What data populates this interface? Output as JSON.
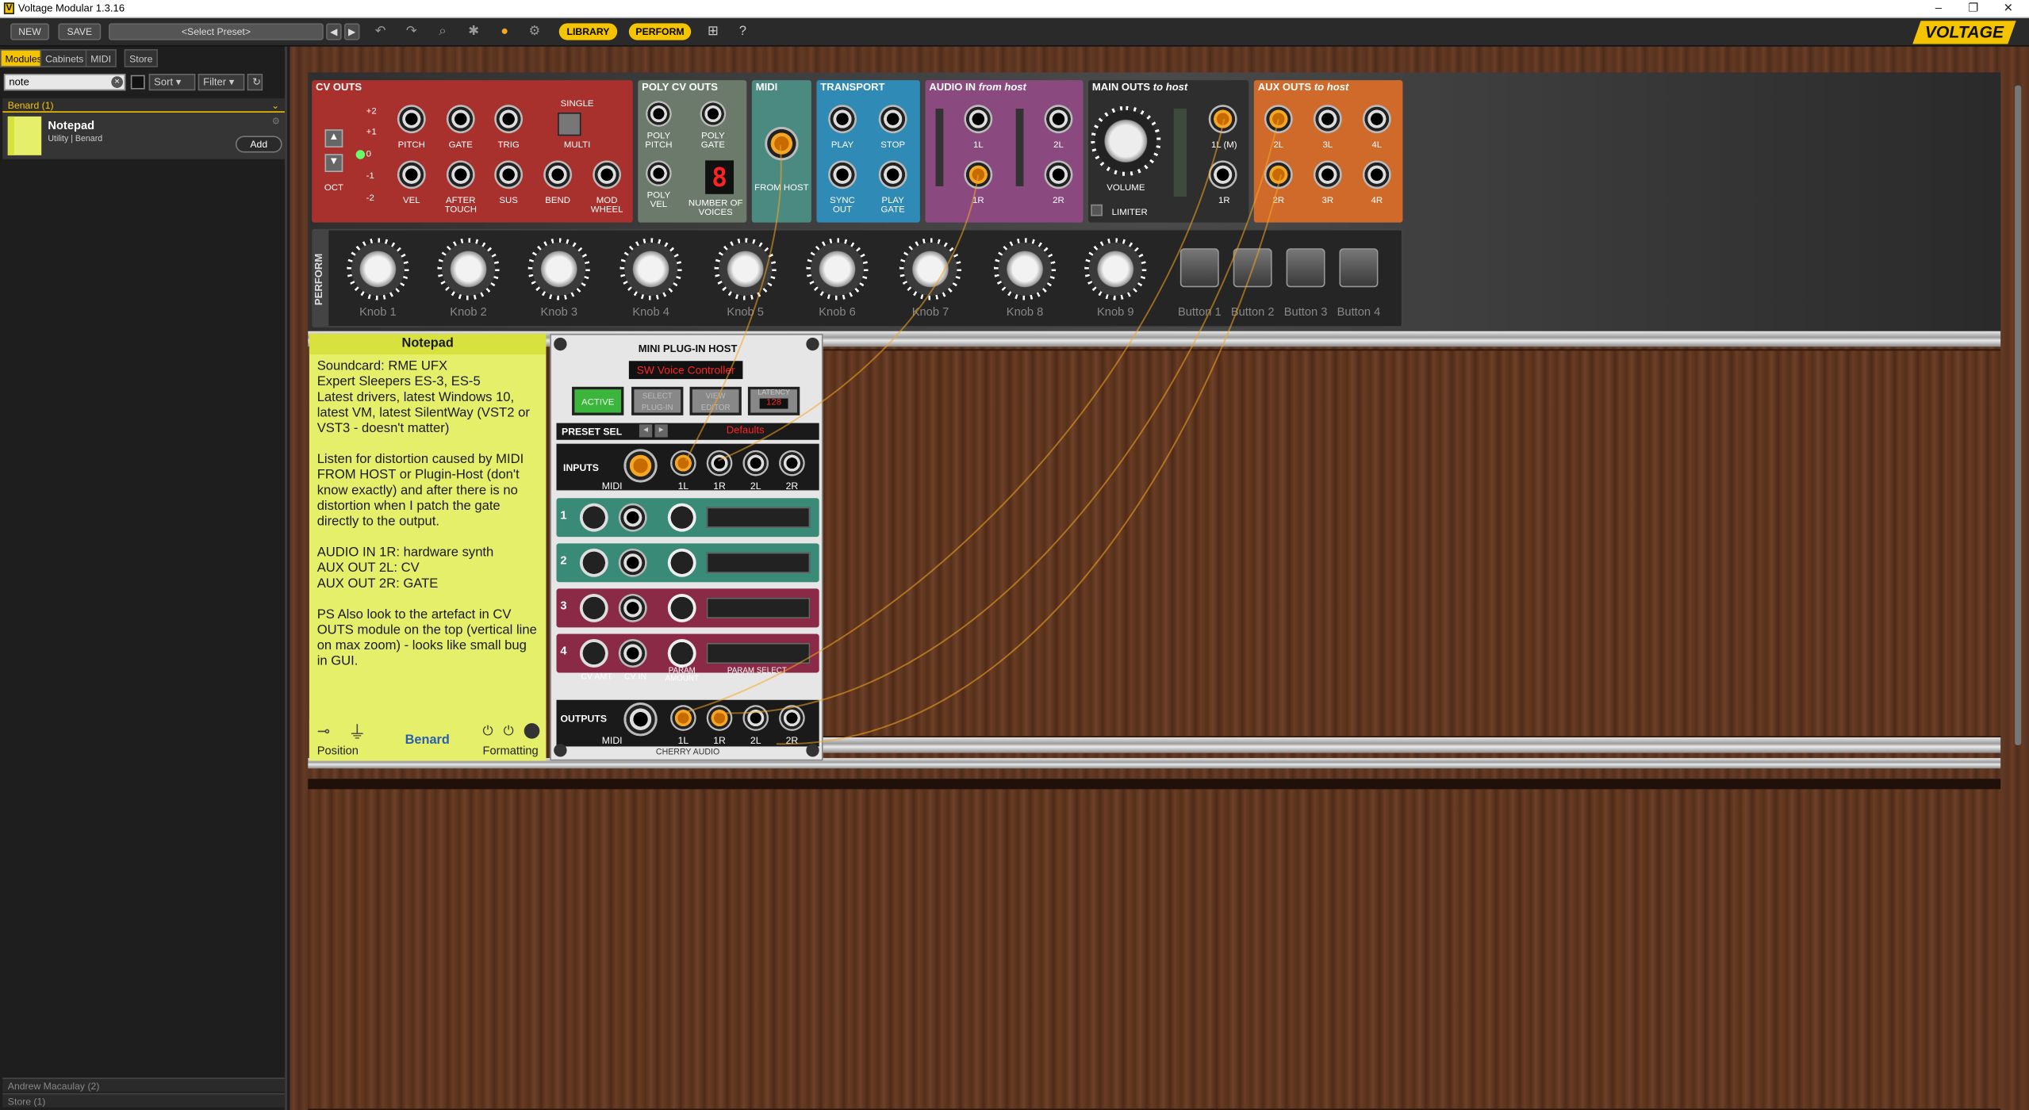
{
  "window": {
    "title": "Voltage Modular 1.3.16",
    "controls": [
      "–",
      "❐",
      "✕"
    ]
  },
  "toolbar": {
    "new": "NEW",
    "save": "SAVE",
    "preset": "<Select Preset>",
    "library": "LIBRARY",
    "perform": "PERFORM",
    "brand": "VOLTAGE"
  },
  "sidebar": {
    "tabs": [
      "Modules",
      "Cabinets",
      "MIDI",
      "Store"
    ],
    "search_value": "note",
    "sort": "Sort",
    "filter": "Filter",
    "group": "Benard  (1)",
    "item": {
      "name": "Notepad",
      "meta": "Utility  |  Benard",
      "add": "Add"
    },
    "footers": [
      "Andrew Macaulay  (2)",
      "Store  (1)"
    ]
  },
  "cv_outs": {
    "title": "CV OUTS",
    "single": "SINGLE",
    "multi": "MULTI",
    "oct": "OCT",
    "octs": [
      "+2",
      "+1",
      "0",
      "-1",
      "-2"
    ],
    "jacks_top": [
      "PITCH",
      "GATE",
      "TRIG"
    ],
    "jacks_bottom": [
      "VEL",
      "AFTER TOUCH",
      "SUS",
      "BEND",
      "MOD WHEEL"
    ]
  },
  "poly_cv": {
    "title": "POLY CV OUTS",
    "labels": [
      "POLY PITCH",
      "POLY GATE",
      "POLY VEL"
    ],
    "voices_label": "NUMBER OF VOICES",
    "voices": "8"
  },
  "midi": {
    "title": "MIDI",
    "label": "FROM HOST"
  },
  "transport": {
    "title": "TRANSPORT",
    "labels": [
      "PLAY",
      "STOP",
      "SYNC OUT",
      "PLAY GATE"
    ]
  },
  "audio_in": {
    "title": "AUDIO IN",
    "sub": "from host",
    "labels": [
      "1L",
      "2L",
      "1R",
      "2R"
    ]
  },
  "main_outs": {
    "title": "MAIN OUTS",
    "sub": "to host",
    "volume": "VOLUME",
    "limiter": "LIMITER",
    "labels": [
      "1L (M)",
      "1R"
    ]
  },
  "aux_outs": {
    "title": "AUX OUTS",
    "sub": "to host",
    "labels": [
      "2L",
      "3L",
      "4L",
      "2R",
      "3R",
      "4R"
    ]
  },
  "perform": {
    "title": "PERFORM",
    "knobs": [
      "Knob 1",
      "Knob 2",
      "Knob 3",
      "Knob 4",
      "Knob 5",
      "Knob 6",
      "Knob 7",
      "Knob 8",
      "Knob 9"
    ],
    "buttons": [
      "Button 1",
      "Button 2",
      "Button 3",
      "Button 4"
    ]
  },
  "notepad": {
    "title": "Notepad",
    "text": "Soundcard: RME UFX\nExpert Sleepers ES-3, ES-5\nLatest drivers, latest Windows 10, latest VM, latest SilentWay (VST2 or VST3 - doesn't matter)\n\nListen for distortion caused by MIDI FROM HOST or Plugin-Host (don't know exactly) and after there is no distortion when I patch the gate directly to the output.\n\nAUDIO IN 1R: hardware synth\nAUX OUT 2L: CV\nAUX OUT 2R: GATE\n\nPS Also look to the artefact in CV OUTS module on the top (vertical line on max zoom) - looks like small bug in GUI.",
    "position": "Position",
    "author": "Benard",
    "formatting": "Formatting"
  },
  "host": {
    "title": "MINI PLUG-IN HOST",
    "plugin": "SW Voice Controller",
    "active": "ACTIVE",
    "select": "SELECT PLUG-IN",
    "view": "VIEW EDITOR",
    "latency_label": "LATENCY",
    "latency": "128",
    "preset_sel": "PRESET SEL",
    "preset": "Defaults",
    "inputs": "INPUTS",
    "outputs": "OUTPUTS",
    "midi": "MIDI",
    "io": [
      "1L",
      "1R",
      "2L",
      "2R"
    ],
    "rows": [
      "1",
      "2",
      "3",
      "4"
    ],
    "row_labels": [
      "CV AMT",
      "CV IN",
      "PARAM AMOUNT",
      "PARAM SELECT"
    ],
    "maker": "CHERRY AUDIO"
  }
}
